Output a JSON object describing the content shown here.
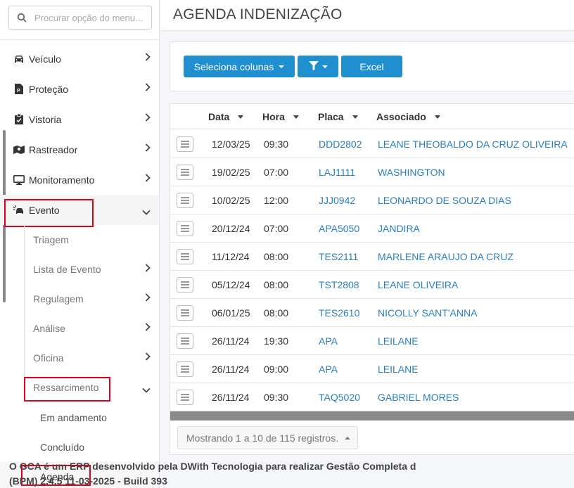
{
  "search": {
    "placeholder": "Procurar opção do menu..."
  },
  "sidebar": {
    "items": [
      {
        "label": "Veículo",
        "icon": "car-icon"
      },
      {
        "label": "Proteção",
        "icon": "shield-doc-icon"
      },
      {
        "label": "Vistoria",
        "icon": "clipboard-icon"
      },
      {
        "label": "Rastreador",
        "icon": "map-icon"
      },
      {
        "label": "Monitoramento",
        "icon": "monitor-icon"
      },
      {
        "label": "Evento",
        "icon": "car-crash-icon"
      }
    ],
    "evento_sub": [
      {
        "label": "Triagem"
      },
      {
        "label": "Lista de Evento"
      },
      {
        "label": "Regulagem"
      },
      {
        "label": "Análise"
      },
      {
        "label": "Oficina"
      },
      {
        "label": "Ressarcimento"
      }
    ],
    "ressarcimento_sub": [
      {
        "label": "Em andamento"
      },
      {
        "label": "Concluído"
      },
      {
        "label": "Agenda"
      }
    ]
  },
  "page": {
    "title": "AGENDA INDENIZAÇÃO"
  },
  "toolbar": {
    "columns_label": "Seleciona colunas",
    "filter_icon": "filter-icon",
    "excel_label": "Excel",
    "accent": "#1f8fd0"
  },
  "table": {
    "headers": {
      "data": "Data",
      "hora": "Hora",
      "placa": "Placa",
      "associado": "Associado"
    },
    "rows": [
      {
        "data": "12/03/25",
        "hora": "09:30",
        "placa": "DDD2802",
        "associado": "LEANE THEOBALDO DA CRUZ OLIVEIRA"
      },
      {
        "data": "19/02/25",
        "hora": "07:00",
        "placa": "LAJ1111",
        "associado": "WASHINGTON"
      },
      {
        "data": "10/02/25",
        "hora": "12:00",
        "placa": "JJJ0942",
        "associado": "LEONARDO DE SOUZA DIAS"
      },
      {
        "data": "20/12/24",
        "hora": "07:00",
        "placa": "APA5050",
        "associado": "JANDIRA"
      },
      {
        "data": "11/12/24",
        "hora": "08:00",
        "placa": "TES2111",
        "associado": "MARLENE ARAUJO DA CRUZ"
      },
      {
        "data": "05/12/24",
        "hora": "08:00",
        "placa": "TST2808",
        "associado": "LEANE OLIVEIRA"
      },
      {
        "data": "06/01/25",
        "hora": "08:00",
        "placa": "TES2610",
        "associado": "NICOLLY SANT'ANNA"
      },
      {
        "data": "26/11/24",
        "hora": "19:30",
        "placa": "APA",
        "associado": "LEILANE"
      },
      {
        "data": "26/11/24",
        "hora": "09:00",
        "placa": "APA",
        "associado": "LEILANE"
      },
      {
        "data": "26/11/24",
        "hora": "09:30",
        "placa": "TAQ5020",
        "associado": "GABRIEL MORES"
      }
    ],
    "info": "Mostrando 1 a 10 de 115 registros."
  },
  "footer": {
    "line1": "O GCA é um ERP desenvolvido pela DWith Tecnologia para realizar Gestão Completa d",
    "line2": "(BPM) 2.4.5 11-03-2025 - Build 393"
  }
}
